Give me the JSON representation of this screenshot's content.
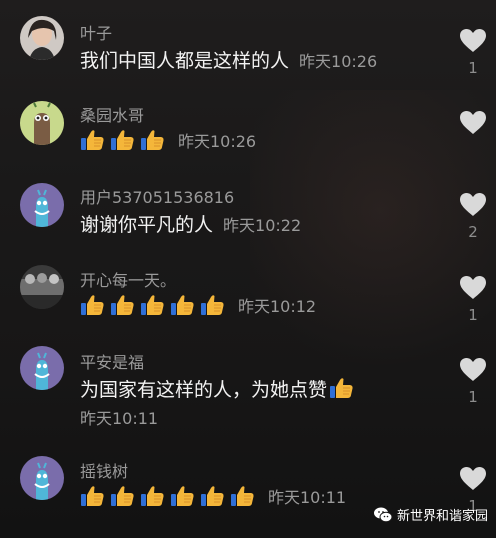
{
  "comments": [
    {
      "username": "叶子",
      "text": "我们中国人都是这样的人",
      "time": "昨天10:26",
      "likes": "1"
    },
    {
      "username": "桑园水哥",
      "time": "昨天10:26",
      "likes": ""
    },
    {
      "username": "用户537051536816",
      "text": "谢谢你平凡的人",
      "time": "昨天10:22",
      "likes": "2"
    },
    {
      "username": "开心每一天。",
      "time": "昨天10:12",
      "likes": "1"
    },
    {
      "username": "平安是福",
      "text": "为国家有这样的人，为她点赞",
      "time": "昨天10:11",
      "likes": "1"
    },
    {
      "username": "摇钱树",
      "time": "昨天10:11",
      "likes": "1"
    }
  ],
  "watermark": {
    "label": "新世界和谐家园"
  },
  "icons": {
    "like": "heart-icon",
    "emoji": "thumbs-up-icon",
    "watermark": "wechat-icon"
  },
  "colors": {
    "background": "#1a1919",
    "text": "#f2f2f2",
    "muted": "#9a9a9a",
    "heart": "#d9d9d9"
  }
}
